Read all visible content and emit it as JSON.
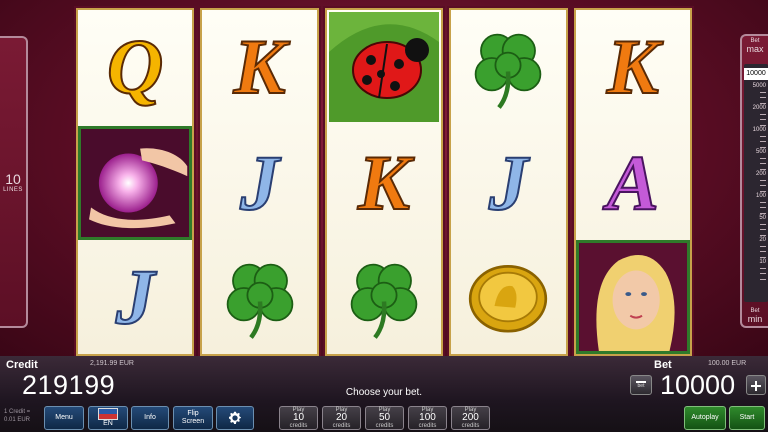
{
  "left_panel": {
    "lines_value": "10",
    "lines_label": "LINES"
  },
  "reels": [
    [
      "Q",
      "ball-hands",
      "J"
    ],
    [
      "K",
      "J",
      "clover"
    ],
    [
      "ladybug",
      "K",
      "clover"
    ],
    [
      "clover",
      "J",
      "coin"
    ],
    [
      "K",
      "A",
      "lady"
    ]
  ],
  "bet_slider": {
    "top_label": "Bet",
    "top_max": "max",
    "selected": "10000",
    "levels": [
      "5000",
      "2000",
      "1000",
      "500",
      "200",
      "100",
      "50",
      "20",
      "10"
    ],
    "bottom_label": "Bet",
    "bottom_min": "min"
  },
  "bottom": {
    "credit_label": "Credit",
    "credit_eur": "2,191.99 EUR",
    "credit_value": "219199",
    "bet_label": "Bet",
    "bet_eur": "100.00 EUR",
    "bet_value": "10000",
    "minus_label": "bet",
    "message": "Choose your bet.",
    "rate_line1": "1 Credit =",
    "rate_line2": "0.01 EUR",
    "menu_label": "Menu",
    "lang_label": "EN",
    "info_label": "Info",
    "flip_line1": "Flip",
    "flip_line2": "Screen",
    "play_buttons": [
      {
        "top": "Play",
        "value": "10",
        "unit": "credits"
      },
      {
        "top": "Play",
        "value": "20",
        "unit": "credits"
      },
      {
        "top": "Play",
        "value": "50",
        "unit": "credits"
      },
      {
        "top": "Play",
        "value": "100",
        "unit": "credits"
      },
      {
        "top": "Play",
        "value": "200",
        "unit": "credits"
      }
    ],
    "autoplay_label": "Autoplay",
    "start_label": "Start"
  },
  "colors": {
    "background": "#5a0f22",
    "reel_bg": "#fffef6",
    "reel_border": "#c7a24a",
    "button_blue": "#1a3a64",
    "button_green": "#226e20"
  }
}
